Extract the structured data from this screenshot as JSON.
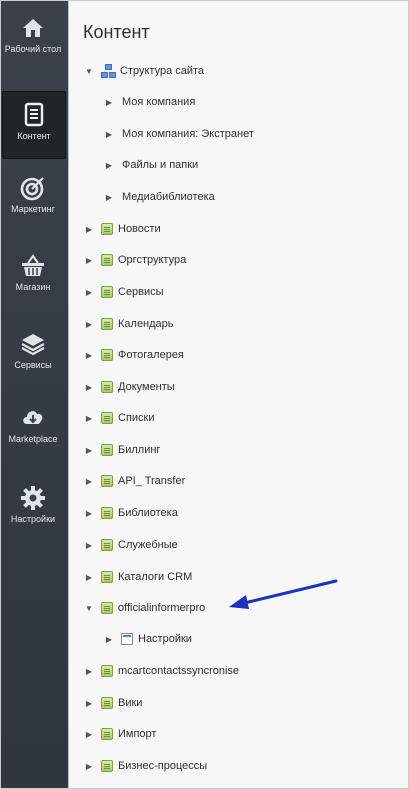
{
  "sidebar": {
    "items": [
      {
        "label": "Рабочий стол",
        "icon": "home-icon",
        "active": false
      },
      {
        "label": "Контент",
        "icon": "document-icon",
        "active": true
      },
      {
        "label": "Маркетинг",
        "icon": "target-icon",
        "active": false
      },
      {
        "label": "Магазин",
        "icon": "basket-icon",
        "active": false
      },
      {
        "label": "Сервисы",
        "icon": "layers-icon",
        "active": false
      },
      {
        "label": "Marketplace",
        "icon": "cloud-download-icon",
        "active": false
      },
      {
        "label": "Настройки",
        "icon": "gear-icon",
        "active": false
      }
    ]
  },
  "main": {
    "title": "Контент",
    "tree": [
      {
        "label": "Структура сайта",
        "icon": "sitemap-icon",
        "expanded": true
      },
      {
        "label": "Моя компания",
        "icon": "none"
      },
      {
        "label": "Моя компания: Экстранет",
        "icon": "none"
      },
      {
        "label": "Файлы и папки",
        "icon": "none"
      },
      {
        "label": "Медиабиблиотека",
        "icon": "none"
      },
      {
        "label": "Новости",
        "icon": "iblock-icon"
      },
      {
        "label": "Оргструктура",
        "icon": "iblock-icon"
      },
      {
        "label": "Сервисы",
        "icon": "iblock-icon"
      },
      {
        "label": "Календарь",
        "icon": "iblock-icon"
      },
      {
        "label": "Фотогалерея",
        "icon": "iblock-icon"
      },
      {
        "label": "Документы",
        "icon": "iblock-icon"
      },
      {
        "label": "Списки",
        "icon": "iblock-icon"
      },
      {
        "label": "Биллинг",
        "icon": "iblock-icon"
      },
      {
        "label": "API_ Transfer",
        "icon": "iblock-icon"
      },
      {
        "label": "Библиотека",
        "icon": "iblock-icon"
      },
      {
        "label": "Служебные",
        "icon": "iblock-icon"
      },
      {
        "label": "Каталоги CRM",
        "icon": "iblock-icon"
      },
      {
        "label": "officialinformerpro",
        "icon": "iblock-icon",
        "expanded": true
      },
      {
        "label": "Настройки",
        "icon": "form-icon"
      },
      {
        "label": "mcartcontactssyncronise",
        "icon": "iblock-icon"
      },
      {
        "label": "Вики",
        "icon": "iblock-icon"
      },
      {
        "label": "Импорт",
        "icon": "iblock-icon"
      },
      {
        "label": "Бизнес-процессы",
        "icon": "iblock-icon"
      }
    ]
  },
  "annotation": {
    "color": "#1f2fbf"
  }
}
